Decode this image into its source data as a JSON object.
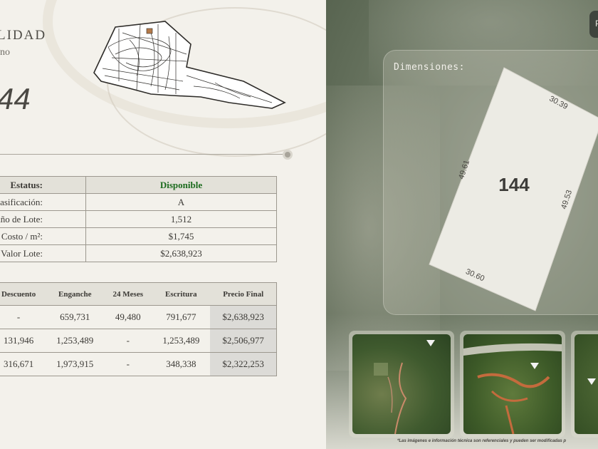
{
  "header": {
    "title": "LIDAD",
    "subtitle": "no",
    "lot_number": "44"
  },
  "info_table": [
    {
      "label": "Estatus:",
      "value": "Disponible"
    },
    {
      "label": "Clasificación:",
      "value": "A"
    },
    {
      "label": "amaño de Lote:",
      "value": "1,512"
    },
    {
      "label": "Costo / m²:",
      "value": "$1,745"
    },
    {
      "label": "Valor Lote:",
      "value": "$2,638,923"
    }
  ],
  "plans_table": {
    "headers": [
      "Descuento",
      "Enganche",
      "24 Meses",
      "Escritura",
      "Precio Final"
    ],
    "rows": [
      [
        "-",
        "659,731",
        "49,480",
        "791,677",
        "$2,638,923"
      ],
      [
        "131,946",
        "1,253,489",
        "-",
        "1,253,489",
        "$2,506,977"
      ],
      [
        "316,671",
        "1,973,915",
        "-",
        "348,338",
        "$2,322,253"
      ]
    ]
  },
  "dimensions": {
    "title": "Dimensiones:",
    "lot_label": "144",
    "side_top": "30.39",
    "side_left": "49.61",
    "side_right": "49.53",
    "side_bottom": "30.60"
  },
  "corner_button": "P",
  "disclaimer": "*Las imágenes e información técnica son referenciales y pueden ser modificadas p",
  "colors": {
    "status_available": "#1c6b1e",
    "panel_bg": "#f3f1eb",
    "table_header_bg": "#e3e1d9"
  }
}
